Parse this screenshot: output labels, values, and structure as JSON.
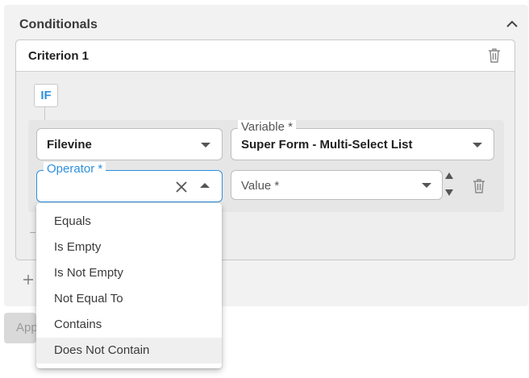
{
  "conditionals": {
    "title": "Conditionals",
    "icons": {
      "collapse": "chevron-up-icon",
      "add": "plus-icon"
    }
  },
  "criterion": {
    "title": "Criterion 1",
    "if_label": "IF",
    "icons": {
      "delete": "trash-icon"
    }
  },
  "row": {
    "source": {
      "value": "Filevine"
    },
    "variable": {
      "label": "Variable *",
      "value": "Super Form - Multi-Select List"
    },
    "operator": {
      "label": "Operator *",
      "value": ""
    },
    "value_field": {
      "placeholder": "Value *"
    }
  },
  "operator_options": [
    "Equals",
    "Is Empty",
    "Is Not Empty",
    "Not Equal To",
    "Contains",
    "Does Not Contain"
  ],
  "highlighted_option": "Does Not Contain",
  "footer": {
    "apply_label": "Apply"
  },
  "colors": {
    "accent": "#2f8fdc",
    "panel_bg": "#f2f2f2"
  }
}
